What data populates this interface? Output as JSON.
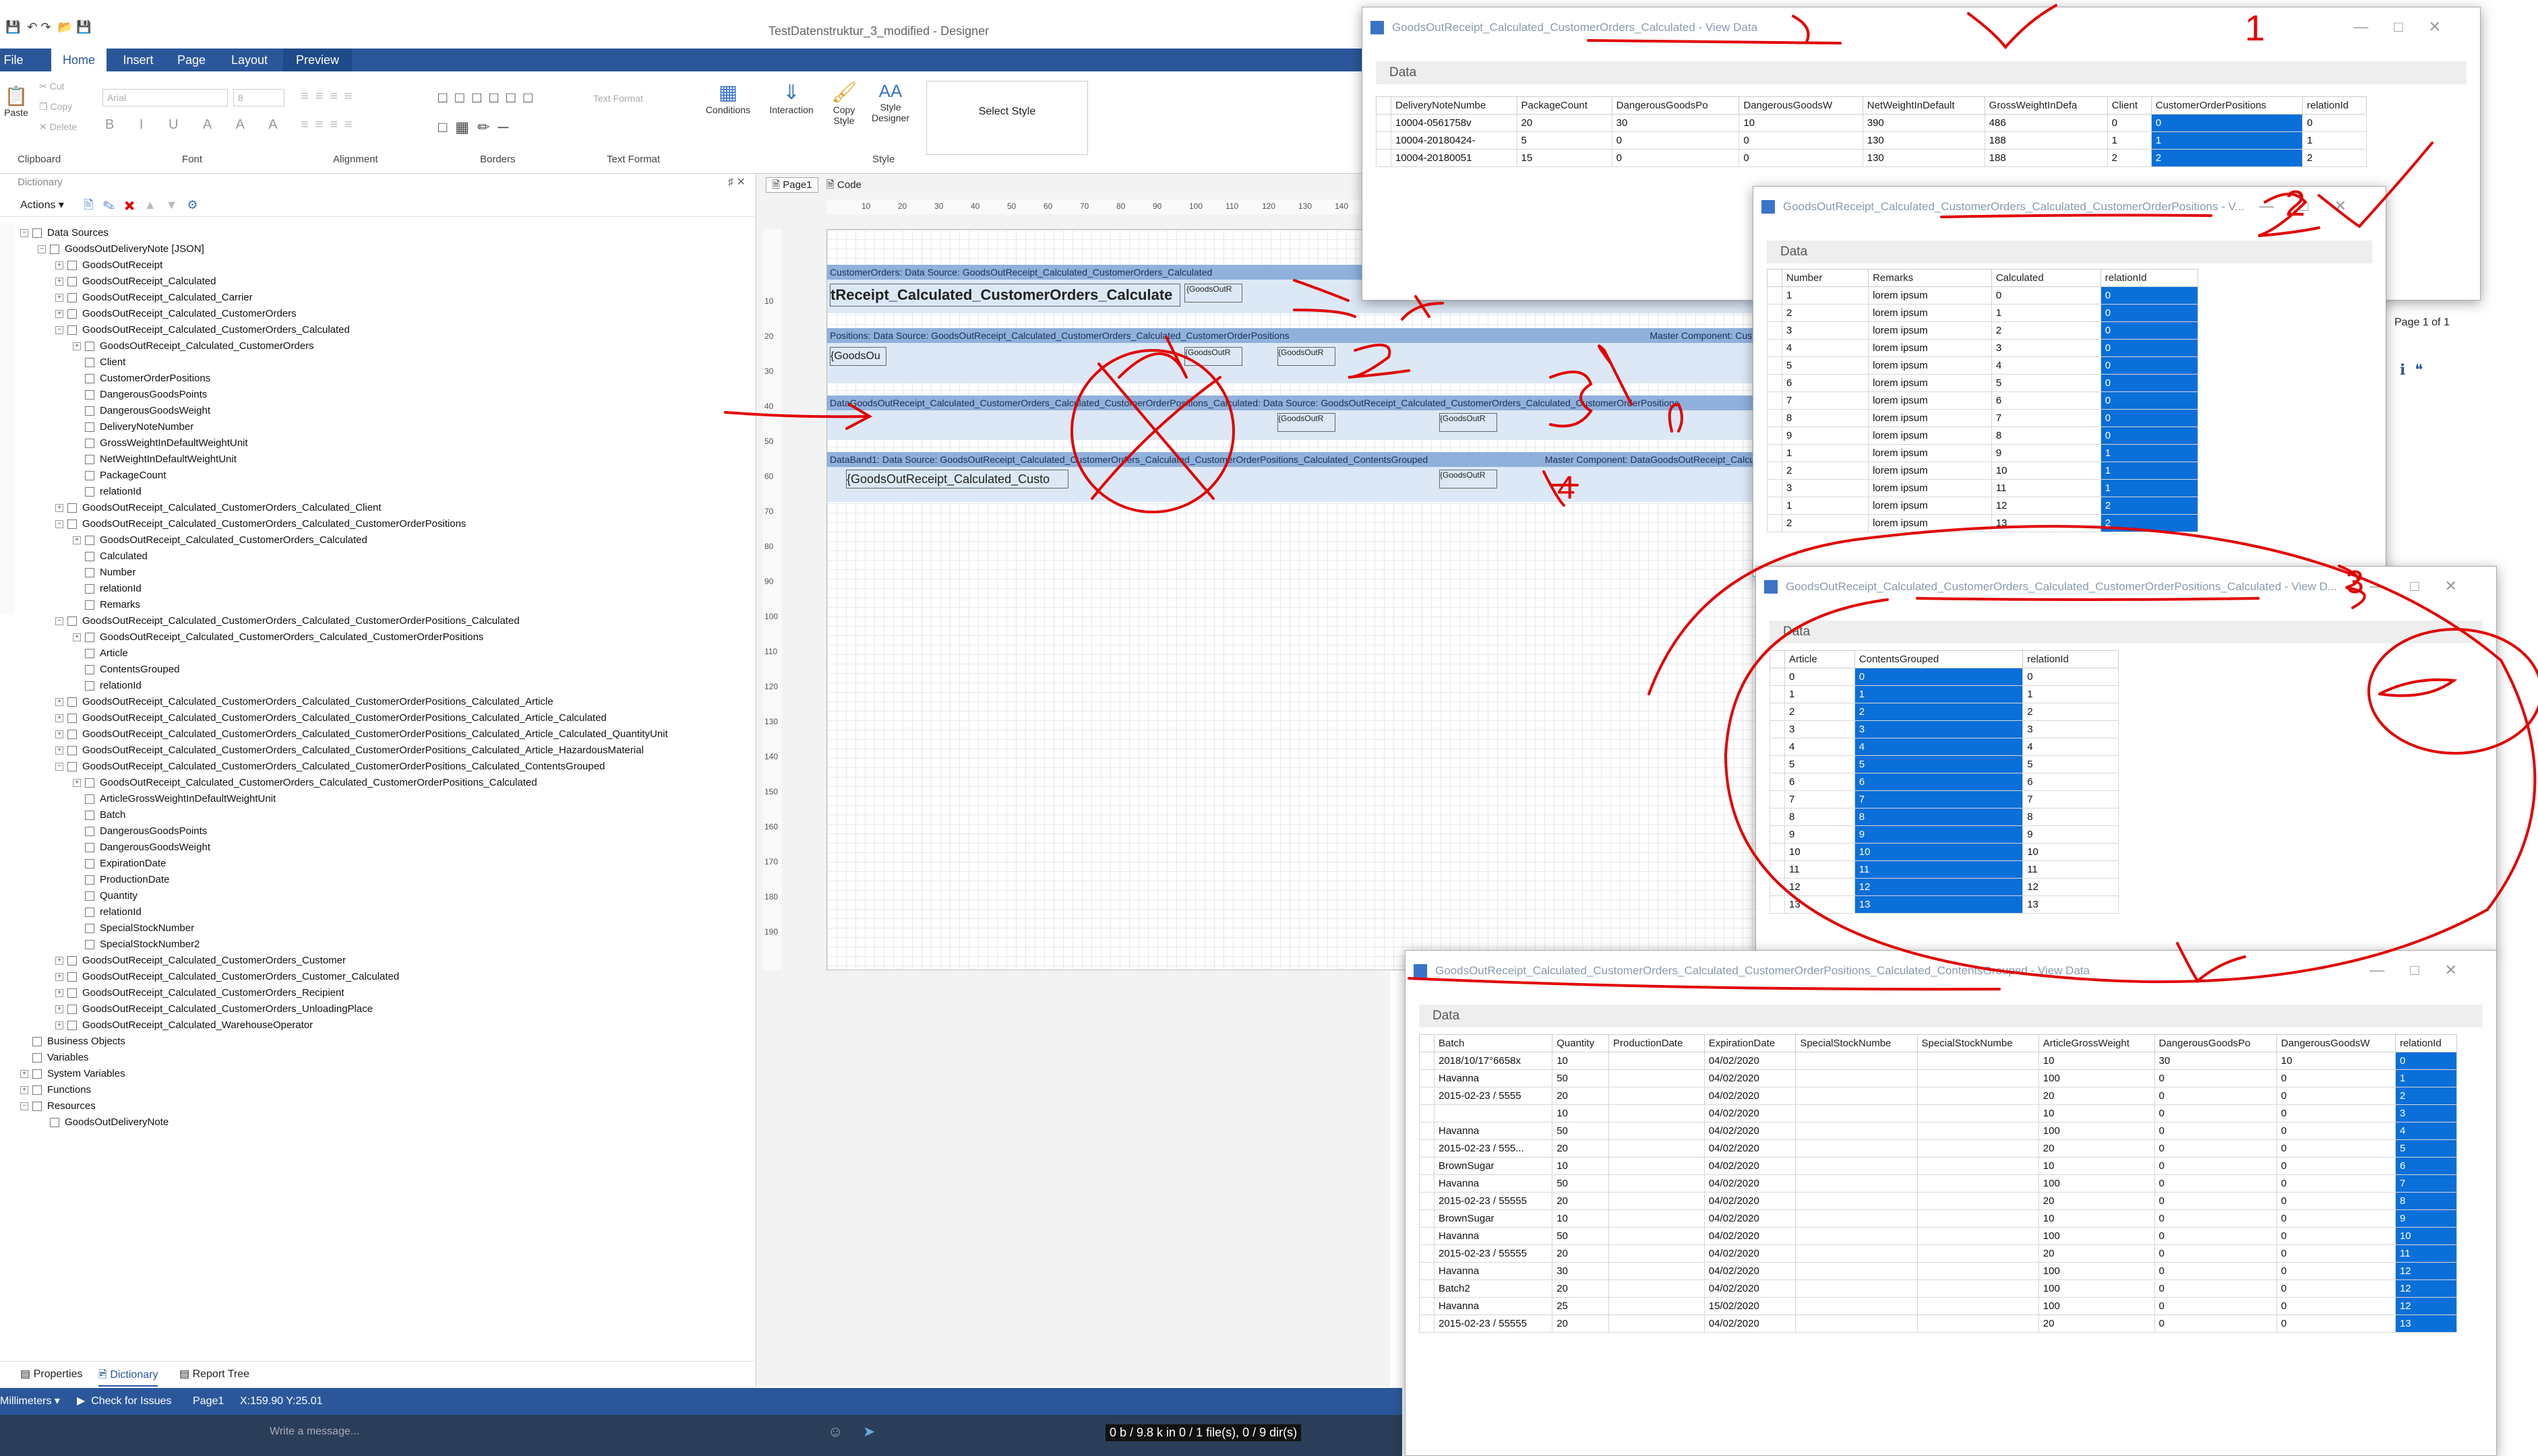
{
  "app": {
    "title": "TestDatenstruktur_3_modified - Designer"
  },
  "menu": {
    "file": "File",
    "tabs": [
      "Home",
      "Insert",
      "Page",
      "Layout",
      "Preview"
    ]
  },
  "ribbon": {
    "clipboard": {
      "label": "Clipboard",
      "paste": "Paste",
      "cut": "Cut",
      "copy": "Copy",
      "delete": "Delete"
    },
    "font": {
      "label": "Font",
      "family": "Arial",
      "size": "8"
    },
    "alignment": {
      "label": "Alignment"
    },
    "borders": {
      "label": "Borders"
    },
    "textformat": {
      "label": "Text Format",
      "field": "Text Format"
    },
    "style": {
      "label": "Style",
      "conditions": "Conditions",
      "interaction": "Interaction",
      "copy_style": "Copy Style",
      "style_designer": "Style Designer",
      "select_style": "Select Style"
    }
  },
  "dictionary": {
    "title": "Dictionary",
    "actions": "Actions",
    "tree": [
      {
        "level": 0,
        "text": "Data Sources",
        "expanded": true
      },
      {
        "level": 1,
        "text": "GoodsOutDeliveryNote [JSON]",
        "expanded": true
      },
      {
        "level": 2,
        "text": "GoodsOutReceipt",
        "expanded": false
      },
      {
        "level": 2,
        "text": "GoodsOutReceipt_Calculated",
        "expanded": false
      },
      {
        "level": 2,
        "text": "GoodsOutReceipt_Calculated_Carrier",
        "expanded": false
      },
      {
        "level": 2,
        "text": "GoodsOutReceipt_Calculated_CustomerOrders",
        "expanded": false
      },
      {
        "level": 2,
        "text": "GoodsOutReceipt_Calculated_CustomerOrders_Calculated",
        "expanded": true
      },
      {
        "level": 3,
        "text": "GoodsOutReceipt_Calculated_CustomerOrders",
        "expanded": false
      },
      {
        "level": 3,
        "text": "Client"
      },
      {
        "level": 3,
        "text": "CustomerOrderPositions"
      },
      {
        "level": 3,
        "text": "DangerousGoodsPoints"
      },
      {
        "level": 3,
        "text": "DangerousGoodsWeight"
      },
      {
        "level": 3,
        "text": "DeliveryNoteNumber"
      },
      {
        "level": 3,
        "text": "GrossWeightInDefaultWeightUnit"
      },
      {
        "level": 3,
        "text": "NetWeightInDefaultWeightUnit"
      },
      {
        "level": 3,
        "text": "PackageCount"
      },
      {
        "level": 3,
        "text": "relationId"
      },
      {
        "level": 2,
        "text": "GoodsOutReceipt_Calculated_CustomerOrders_Calculated_Client",
        "expanded": false
      },
      {
        "level": 2,
        "text": "GoodsOutReceipt_Calculated_CustomerOrders_Calculated_CustomerOrderPositions",
        "expanded": true
      },
      {
        "level": 3,
        "text": "GoodsOutReceipt_Calculated_CustomerOrders_Calculated",
        "expanded": false
      },
      {
        "level": 3,
        "text": "Calculated"
      },
      {
        "level": 3,
        "text": "Number"
      },
      {
        "level": 3,
        "text": "relationId"
      },
      {
        "level": 3,
        "text": "Remarks"
      },
      {
        "level": 2,
        "text": "GoodsOutReceipt_Calculated_CustomerOrders_Calculated_CustomerOrderPositions_Calculated",
        "expanded": true
      },
      {
        "level": 3,
        "text": "GoodsOutReceipt_Calculated_CustomerOrders_Calculated_CustomerOrderPositions",
        "expanded": false
      },
      {
        "level": 3,
        "text": "Article"
      },
      {
        "level": 3,
        "text": "ContentsGrouped"
      },
      {
        "level": 3,
        "text": "relationId"
      },
      {
        "level": 2,
        "text": "GoodsOutReceipt_Calculated_CustomerOrders_Calculated_CustomerOrderPositions_Calculated_Article",
        "expanded": false
      },
      {
        "level": 2,
        "text": "GoodsOutReceipt_Calculated_CustomerOrders_Calculated_CustomerOrderPositions_Calculated_Article_Calculated",
        "expanded": false
      },
      {
        "level": 2,
        "text": "GoodsOutReceipt_Calculated_CustomerOrders_Calculated_CustomerOrderPositions_Calculated_Article_Calculated_QuantityUnit",
        "expanded": false
      },
      {
        "level": 2,
        "text": "GoodsOutReceipt_Calculated_CustomerOrders_Calculated_CustomerOrderPositions_Calculated_Article_HazardousMaterial",
        "expanded": false
      },
      {
        "level": 2,
        "text": "GoodsOutReceipt_Calculated_CustomerOrders_Calculated_CustomerOrderPositions_Calculated_ContentsGrouped",
        "expanded": true
      },
      {
        "level": 3,
        "text": "GoodsOutReceipt_Calculated_CustomerOrders_Calculated_CustomerOrderPositions_Calculated",
        "expanded": false
      },
      {
        "level": 3,
        "text": "ArticleGrossWeightInDefaultWeightUnit"
      },
      {
        "level": 3,
        "text": "Batch"
      },
      {
        "level": 3,
        "text": "DangerousGoodsPoints"
      },
      {
        "level": 3,
        "text": "DangerousGoodsWeight"
      },
      {
        "level": 3,
        "text": "ExpirationDate"
      },
      {
        "level": 3,
        "text": "ProductionDate"
      },
      {
        "level": 3,
        "text": "Quantity"
      },
      {
        "level": 3,
        "text": "relationId"
      },
      {
        "level": 3,
        "text": "SpecialStockNumber"
      },
      {
        "level": 3,
        "text": "SpecialStockNumber2"
      },
      {
        "level": 2,
        "text": "GoodsOutReceipt_Calculated_CustomerOrders_Customer",
        "expanded": false
      },
      {
        "level": 2,
        "text": "GoodsOutReceipt_Calculated_CustomerOrders_Customer_Calculated",
        "expanded": false
      },
      {
        "level": 2,
        "text": "GoodsOutReceipt_Calculated_CustomerOrders_Recipient",
        "expanded": false
      },
      {
        "level": 2,
        "text": "GoodsOutReceipt_Calculated_CustomerOrders_UnloadingPlace",
        "expanded": false
      },
      {
        "level": 2,
        "text": "GoodsOutReceipt_Calculated_WarehouseOperator",
        "expanded": false
      },
      {
        "level": 0,
        "text": "Business Objects"
      },
      {
        "level": 0,
        "text": "Variables"
      },
      {
        "level": 0,
        "text": "System Variables",
        "expanded": false
      },
      {
        "level": 0,
        "text": "Functions",
        "expanded": false
      },
      {
        "level": 0,
        "text": "Resources",
        "expanded": true
      },
      {
        "level": 1,
        "text": "GoodsOutDeliveryNote"
      }
    ],
    "bottom_tabs": [
      "Properties",
      "Dictionary",
      "Report Tree"
    ]
  },
  "designer": {
    "page_tab": "Page1",
    "code_tab": "Code",
    "ruler_marks": [
      "10",
      "20",
      "30",
      "40",
      "50",
      "60",
      "70",
      "80",
      "90",
      "100",
      "110",
      "120",
      "130",
      "140"
    ],
    "vruler_marks": [
      "10",
      "20",
      "30",
      "40",
      "50",
      "60",
      "70",
      "80",
      "90",
      "100",
      "110",
      "120",
      "130",
      "140",
      "150",
      "160",
      "170",
      "180",
      "190"
    ],
    "bands": {
      "b1_header": "CustomerOrders:  Data  Source:  GoodsOutReceipt_Calculated_CustomerOrders_Calculated",
      "b1_text": "tReceipt_Calculated_CustomerOrders_Calculate",
      "b1_small": "{GoodsOutR",
      "b2_header": "Positions:  Data  Source:  GoodsOutReceipt_Calculated_CustomerOrders_Calculated_CustomerOrderPositions",
      "b2_right": "Master Component: Cust",
      "b2_text": "{GoodsOu",
      "b2_small1": "{GoodsOutR",
      "b2_small2": "{GoodsOutR",
      "b3_header": "DataGoodsOutReceipt_Calculated_CustomerOrders_Calculated_CustomerOrderPositions_Calculated:  Data  Source:  GoodsOutReceipt_Calculated_CustomerOrders_Calculated_CustomerOrderPositions",
      "b3_small1": "{GoodsOutR",
      "b3_small2": "{GoodsOutR",
      "b4_header": "DataBand1:  Data  Source:  GoodsOutReceipt_Calculated_CustomerOrders_Calculated_CustomerOrderPositions_Calculated_ContentsGrouped",
      "b4_right": "Master  Component:  DataGoodsOutReceipt_Calcu",
      "b4_text": "{GoodsOutReceipt_Calculated_Custo",
      "b4_small": "{GoodsOutR"
    }
  },
  "status": {
    "units": "Millimeters",
    "check": "Check for Issues",
    "page": "Page1",
    "coords": "X:159.90 Y:25.01"
  },
  "taskbar": {
    "message_placeholder": "Write a message...",
    "files": "0 b / 9.8 k in 0 / 1 file(s), 0 / 9 dir(s)"
  },
  "preview_page": {
    "text": "Page 1 of 1"
  },
  "windows": {
    "w1": {
      "title": "GoodsOutReceipt_Calculated_CustomerOrders_Calculated - View Data",
      "label": "Data",
      "columns": [
        "DeliveryNoteNumbe",
        "PackageCount",
        "DangerousGoodsPo",
        "DangerousGoodsW",
        "NetWeightInDefault",
        "GrossWeightInDefa",
        "Client",
        "CustomerOrderPositions",
        "relationId"
      ],
      "rows": [
        [
          "10004-0561758v",
          "20",
          "30",
          "10",
          "390",
          "486",
          "0",
          "0",
          "0"
        ],
        [
          "10004-20180424-",
          "5",
          "0",
          "0",
          "130",
          "188",
          "1",
          "1",
          "1"
        ],
        [
          "10004-20180051",
          "15",
          "0",
          "0",
          "130",
          "188",
          "2",
          "2",
          "2"
        ]
      ]
    },
    "w2": {
      "title": "GoodsOutReceipt_Calculated_CustomerOrders_Calculated_CustomerOrderPositions - V...",
      "label": "Data",
      "columns": [
        "Number",
        "Remarks",
        "Calculated",
        "relationId"
      ],
      "rows": [
        [
          "1",
          "lorem ipsum",
          "0",
          "0"
        ],
        [
          "2",
          "lorem ipsum",
          "1",
          "0"
        ],
        [
          "3",
          "lorem ipsum",
          "2",
          "0"
        ],
        [
          "4",
          "lorem ipsum",
          "3",
          "0"
        ],
        [
          "5",
          "lorem ipsum",
          "4",
          "0"
        ],
        [
          "6",
          "lorem ipsum",
          "5",
          "0"
        ],
        [
          "7",
          "lorem ipsum",
          "6",
          "0"
        ],
        [
          "8",
          "lorem ipsum",
          "7",
          "0"
        ],
        [
          "9",
          "lorem ipsum",
          "8",
          "0"
        ],
        [
          "1",
          "lorem ipsum",
          "9",
          "1"
        ],
        [
          "2",
          "lorem ipsum",
          "10",
          "1"
        ],
        [
          "3",
          "lorem ipsum",
          "11",
          "1"
        ],
        [
          "1",
          "lorem ipsum",
          "12",
          "2"
        ],
        [
          "2",
          "lorem ipsum",
          "13",
          "2"
        ]
      ]
    },
    "w3": {
      "title": "GoodsOutReceipt_Calculated_CustomerOrders_Calculated_CustomerOrderPositions_Calculated - View D...",
      "label": "Data",
      "columns": [
        "Article",
        "ContentsGrouped",
        "relationId"
      ],
      "rows": [
        [
          "0",
          "0",
          "0"
        ],
        [
          "1",
          "1",
          "1"
        ],
        [
          "2",
          "2",
          "2"
        ],
        [
          "3",
          "3",
          "3"
        ],
        [
          "4",
          "4",
          "4"
        ],
        [
          "5",
          "5",
          "5"
        ],
        [
          "6",
          "6",
          "6"
        ],
        [
          "7",
          "7",
          "7"
        ],
        [
          "8",
          "8",
          "8"
        ],
        [
          "9",
          "9",
          "9"
        ],
        [
          "10",
          "10",
          "10"
        ],
        [
          "11",
          "11",
          "11"
        ],
        [
          "12",
          "12",
          "12"
        ],
        [
          "13",
          "13",
          "13"
        ]
      ]
    },
    "w4": {
      "title": "GoodsOutReceipt_Calculated_CustomerOrders_Calculated_CustomerOrderPositions_Calculated_ContentsGrouped - View Data",
      "label": "Data",
      "columns": [
        "Batch",
        "Quantity",
        "ProductionDate",
        "ExpirationDate",
        "SpecialStockNumbe",
        "SpecialStockNumbe",
        "ArticleGrossWeight",
        "DangerousGoodsPo",
        "DangerousGoodsW",
        "relationId"
      ],
      "rows": [
        [
          "2018/10/17°6658x",
          "10",
          "",
          "04/02/2020",
          "",
          "",
          "10",
          "30",
          "10",
          "0"
        ],
        [
          "Havanna",
          "50",
          "",
          "04/02/2020",
          "",
          "",
          "100",
          "0",
          "0",
          "1"
        ],
        [
          "2015-02-23 / 5555",
          "20",
          "",
          "04/02/2020",
          "",
          "",
          "20",
          "0",
          "0",
          "2"
        ],
        [
          "",
          "10",
          "",
          "04/02/2020",
          "",
          "",
          "10",
          "0",
          "0",
          "3"
        ],
        [
          "Havanna",
          "50",
          "",
          "04/02/2020",
          "",
          "",
          "100",
          "0",
          "0",
          "4"
        ],
        [
          "2015-02-23 / 555...",
          "20",
          "",
          "04/02/2020",
          "",
          "",
          "20",
          "0",
          "0",
          "5"
        ],
        [
          "BrownSugar",
          "10",
          "",
          "04/02/2020",
          "",
          "",
          "10",
          "0",
          "0",
          "6"
        ],
        [
          "Havanna",
          "50",
          "",
          "04/02/2020",
          "",
          "",
          "100",
          "0",
          "0",
          "7"
        ],
        [
          "2015-02-23 / 55555",
          "20",
          "",
          "04/02/2020",
          "",
          "",
          "20",
          "0",
          "0",
          "8"
        ],
        [
          "BrownSugar",
          "10",
          "",
          "04/02/2020",
          "",
          "",
          "10",
          "0",
          "0",
          "9"
        ],
        [
          "Havanna",
          "50",
          "",
          "04/02/2020",
          "",
          "",
          "100",
          "0",
          "0",
          "10"
        ],
        [
          "2015-02-23 / 55555",
          "20",
          "",
          "04/02/2020",
          "",
          "",
          "20",
          "0",
          "0",
          "11"
        ],
        [
          "Havanna",
          "30",
          "",
          "04/02/2020",
          "",
          "",
          "100",
          "0",
          "0",
          "12"
        ],
        [
          "Batch2",
          "20",
          "",
          "04/02/2020",
          "",
          "",
          "100",
          "0",
          "0",
          "12"
        ],
        [
          "Havanna",
          "25",
          "",
          "15/02/2020",
          "",
          "",
          "100",
          "0",
          "0",
          "12"
        ],
        [
          "2015-02-23 / 55555",
          "20",
          "",
          "04/02/2020",
          "",
          "",
          "20",
          "0",
          "0",
          "13"
        ]
      ]
    }
  },
  "annotations": {
    "n1": "1",
    "n2": "2",
    "n3": "3",
    "n4": "4"
  },
  "colors": {
    "accent": "#2b579a",
    "selection": "#0a6fd8",
    "annotation": "#e10000"
  }
}
